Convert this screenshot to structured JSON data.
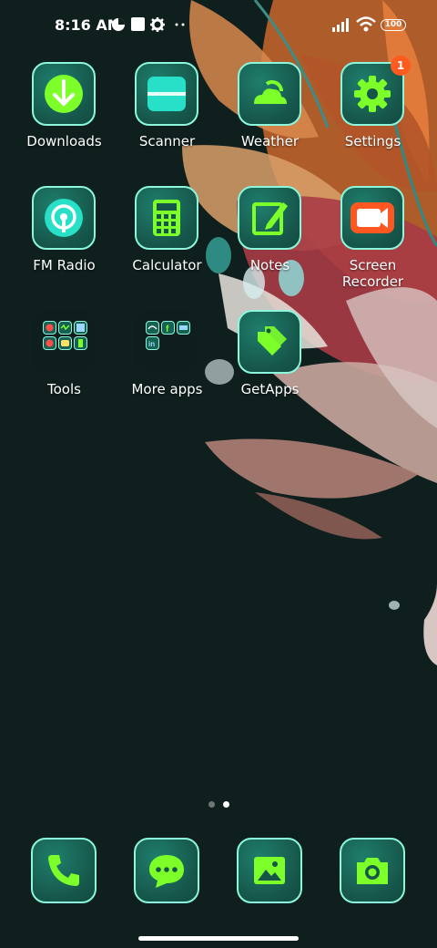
{
  "status_bar": {
    "time": "8:16 AM",
    "battery": "100",
    "left_icons": [
      "data-saver-icon",
      "square-notification-icon",
      "gear-icon",
      "more-dots-icon"
    ],
    "right_icons": [
      "signal-icon",
      "wifi-icon",
      "battery-icon"
    ]
  },
  "apps": [
    {
      "label": "Downloads",
      "icon": "download-arrow-icon"
    },
    {
      "label": "Scanner",
      "icon": "scanner-icon"
    },
    {
      "label": "Weather",
      "icon": "weather-cloud-sun-icon"
    },
    {
      "label": "Settings",
      "icon": "gear-icon",
      "badge": "1"
    },
    {
      "label": "FM Radio",
      "icon": "radio-icon"
    },
    {
      "label": "Calculator",
      "icon": "calculator-icon"
    },
    {
      "label": "Notes",
      "icon": "notes-pencil-icon"
    },
    {
      "label": "Screen\nRecorder",
      "icon": "video-camera-icon"
    },
    {
      "label": "Tools",
      "icon": "folder-icon"
    },
    {
      "label": "More apps",
      "icon": "folder-icon"
    },
    {
      "label": "GetApps",
      "icon": "tag-store-icon"
    }
  ],
  "pages": {
    "count": 2,
    "current": 2
  },
  "dock": [
    {
      "name": "phone",
      "icon": "phone-icon"
    },
    {
      "name": "messages",
      "icon": "message-bubble-icon"
    },
    {
      "name": "gallery",
      "icon": "image-icon"
    },
    {
      "name": "camera",
      "icon": "camera-icon"
    }
  ],
  "colors": {
    "icon_green": "#7dff2a",
    "icon_border": "#8cf7dc",
    "icon_bg": "#16564a",
    "badge": "#ff5a1f",
    "background": "#0f1f1d"
  }
}
